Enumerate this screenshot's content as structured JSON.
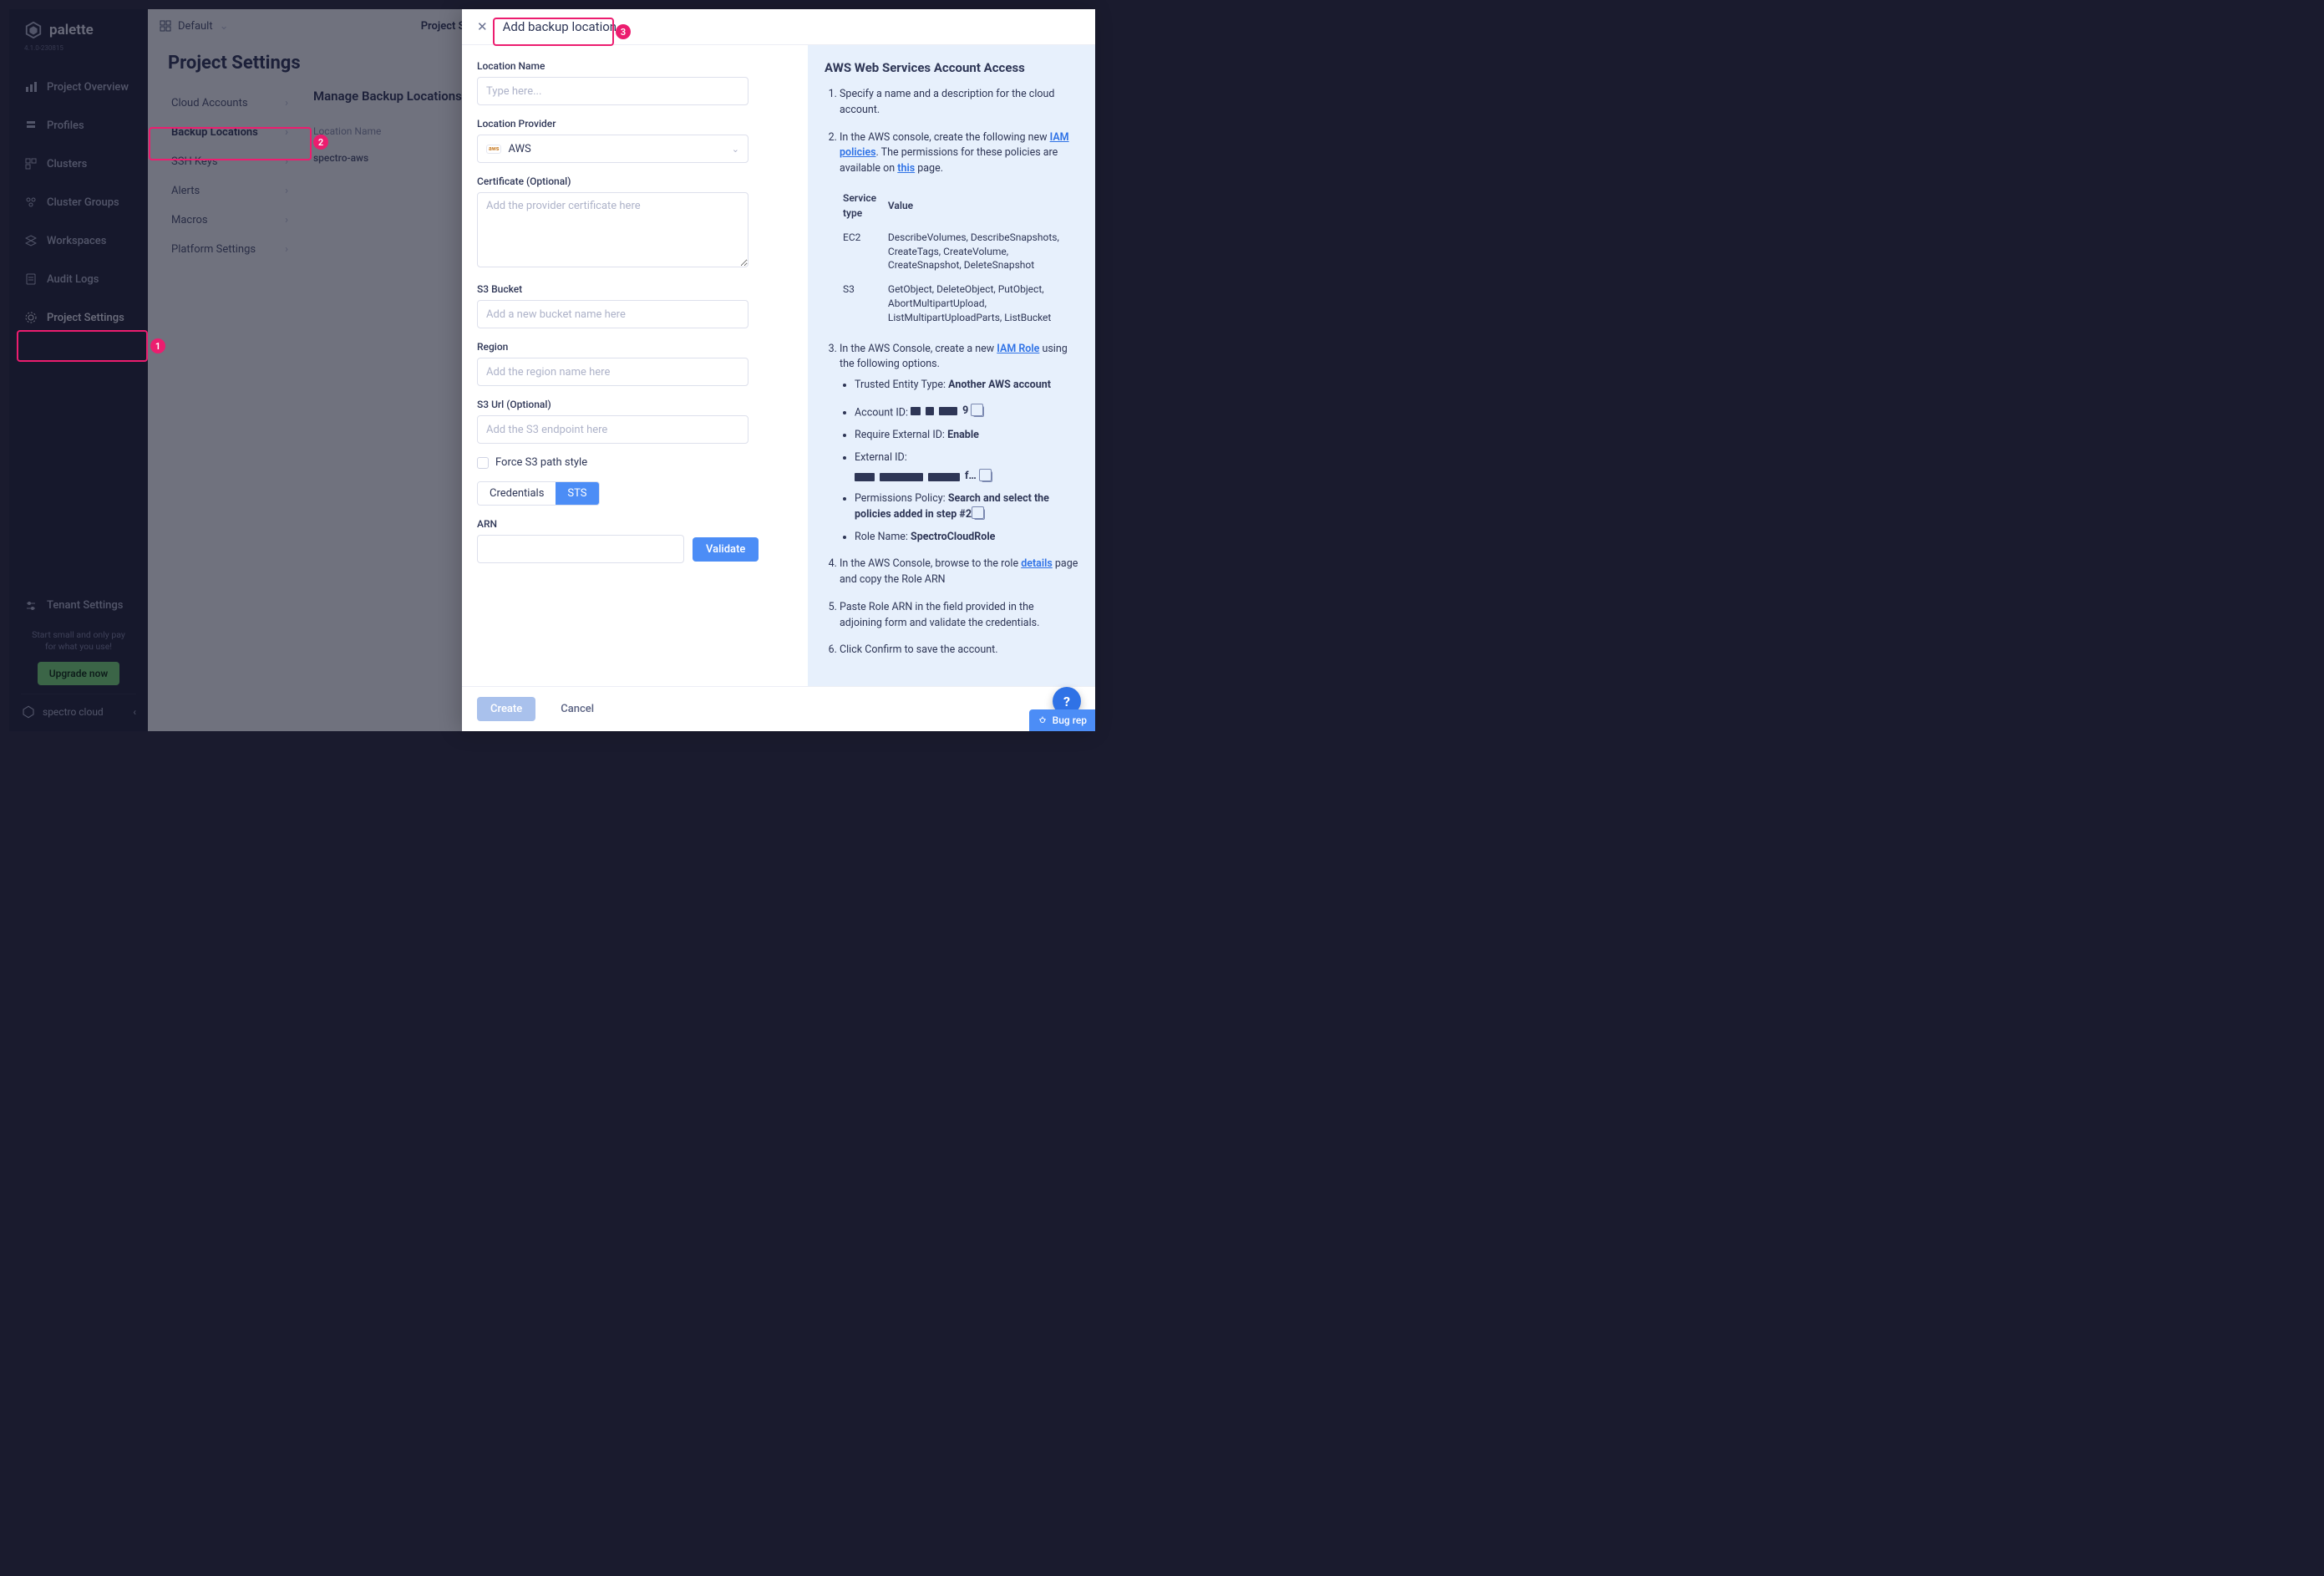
{
  "brand": "palette",
  "build": "4.1.0-230815",
  "sidebar": {
    "items": [
      {
        "label": "Project Overview"
      },
      {
        "label": "Profiles"
      },
      {
        "label": "Clusters"
      },
      {
        "label": "Cluster Groups"
      },
      {
        "label": "Workspaces"
      },
      {
        "label": "Audit Logs"
      },
      {
        "label": "Project Settings"
      }
    ],
    "tenant_settings": "Tenant Settings",
    "promo_line1": "Start small and only pay",
    "promo_line2": "for what you use!",
    "upgrade": "Upgrade now",
    "org": "spectro cloud"
  },
  "topbar": {
    "scope": "Default",
    "breadcrumb_end": "Project Settings"
  },
  "page_title": "Project Settings",
  "settings_side": [
    {
      "label": "Cloud Accounts"
    },
    {
      "label": "Backup Locations"
    },
    {
      "label": "SSH Keys"
    },
    {
      "label": "Alerts"
    },
    {
      "label": "Macros"
    },
    {
      "label": "Platform Settings"
    }
  ],
  "manage": {
    "heading": "Manage Backup Locations",
    "col1": "Location Name",
    "row1": "spectro-aws"
  },
  "panel": {
    "title": "Add backup location",
    "create": "Create",
    "cancel": "Cancel"
  },
  "form": {
    "loc_name": {
      "label": "Location Name",
      "ph": "Type here..."
    },
    "provider": {
      "label": "Location Provider",
      "value": "AWS",
      "badge": "aws"
    },
    "cert": {
      "label": "Certificate (Optional)",
      "ph": "Add the provider certificate here"
    },
    "bucket": {
      "label": "S3 Bucket",
      "ph": "Add a new bucket name here"
    },
    "region": {
      "label": "Region",
      "ph": "Add the region name here"
    },
    "s3url": {
      "label": "S3 Url (Optional)",
      "ph": "Add the S3 endpoint here"
    },
    "force": "Force S3 path style",
    "tab_cred": "Credentials",
    "tab_sts": "STS",
    "arn": {
      "label": "ARN"
    },
    "validate": "Validate"
  },
  "help": {
    "title": "AWS Web Services Account Access",
    "s1": "Specify a name and a description for the cloud account.",
    "s2a": "In the AWS console, create the following new ",
    "s2_link": "IAM policies",
    "s2b": ". The permissions for these policies are available on ",
    "s2_link2": "this",
    "s2c": " page.",
    "tbl_h1": "Service type",
    "tbl_h2": "Value",
    "tbl_r1_c1": "EC2",
    "tbl_r1_c2": "DescribeVolumes, DescribeSnapshots, CreateTags, CreateVolume, CreateSnapshot, DeleteSnapshot",
    "tbl_r2_c1": "S3",
    "tbl_r2_c2": "GetObject, DeleteObject, PutObject, AbortMultipartUpload, ListMultipartUploadParts, ListBucket",
    "s3a": "In the AWS Console, create a new ",
    "s3_link": "IAM Role",
    "s3b": " using the following options.",
    "b1a": "Trusted Entity Type: ",
    "b1b": "Another AWS account",
    "b2a": "Account ID: ",
    "b2_tail": "9",
    "b3a": "Require External ID: ",
    "b3b": "Enable",
    "b4": "External ID:",
    "b4_tail": "f…",
    "b5a": "Permissions Policy: ",
    "b5b": "Search and select the policies added in step #2",
    "b6a": "Role Name: ",
    "b6b": "SpectroCloudRole",
    "s4a": "In the AWS Console, browse to the role ",
    "s4_link": "details",
    "s4b": " page and copy the Role ARN",
    "s5": "Paste Role ARN in the field provided in the adjoining form and validate the credentials.",
    "s6": "Click Confirm to save the account."
  },
  "fab": {
    "help": "?",
    "bug": "Bug rep"
  }
}
